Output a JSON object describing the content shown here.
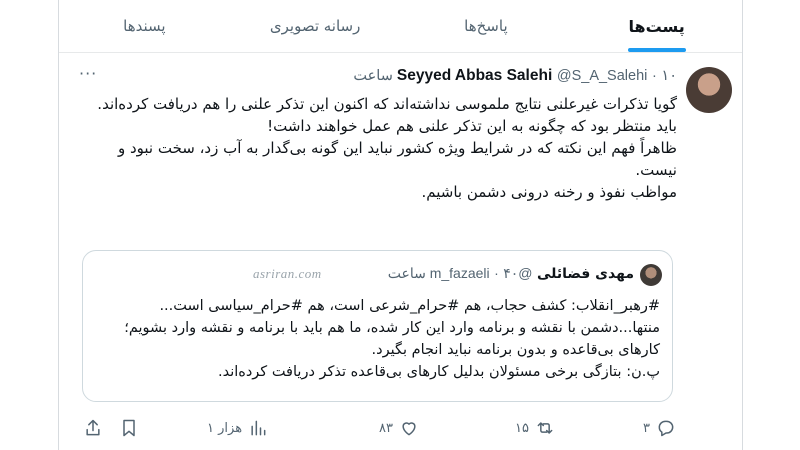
{
  "tabs": [
    {
      "label": "پست‌ها",
      "active": true
    },
    {
      "label": "پاسخ‌ها",
      "active": false
    },
    {
      "label": "رسانه تصویری",
      "active": false
    },
    {
      "label": "پسندها",
      "active": false
    }
  ],
  "post": {
    "author_name": "Seyyed Abbas Salehi",
    "handle": "@S_A_Salehi",
    "time": "۱۰ ساعت",
    "separator": "·",
    "text": "گویا تذکرات غیرعلنی نتایج ملموسی نداشته‌اند که اکنون این تذکر علنی را هم دریافت کرده‌اند.\nباید منتظر بود که چگونه به این تذکر علنی هم عمل خواهند داشت!\nظاهراً فهم این نکته که در شرایط ویژه کشور نباید این گونه بی‌گدار به آب زد، سخت نبود و نیست.\nمواظب  نفوذ و رخنه درونی دشمن باشیم."
  },
  "quote": {
    "author_name": "مهدی فضائلی",
    "handle": "@m_fazaeli",
    "time": "۴۰ ساعت",
    "separator": "·",
    "watermark": "asriran.com",
    "text": "#رهبر_انقلاب: کشف حجاب، هم #حرام_شرعی است، هم #حرام_سیاسی است... منتها...دشمن با نقشه و برنامه وارد این کار شده، ما هم باید با برنامه و نقشه وارد بشویم؛ کارهای بی‌قاعده و بدون برنامه نباید انجام بگیرد.\nپ.ن: بتازگی برخی مسئولان بدلیل کارهای بی‌قاعده تذکر دریافت کرده‌اند."
  },
  "actions": {
    "replies": "۳",
    "retweets": "۱۵",
    "likes": "۸۳",
    "views": "۱ هزار"
  },
  "colors": {
    "accent": "#1d9bf0",
    "muted": "#536471",
    "text": "#0f1419",
    "border": "#cfd9de"
  },
  "icons": [
    "more-icon",
    "reply-icon",
    "retweet-icon",
    "like-icon",
    "views-icon",
    "bookmark-icon",
    "share-icon"
  ]
}
